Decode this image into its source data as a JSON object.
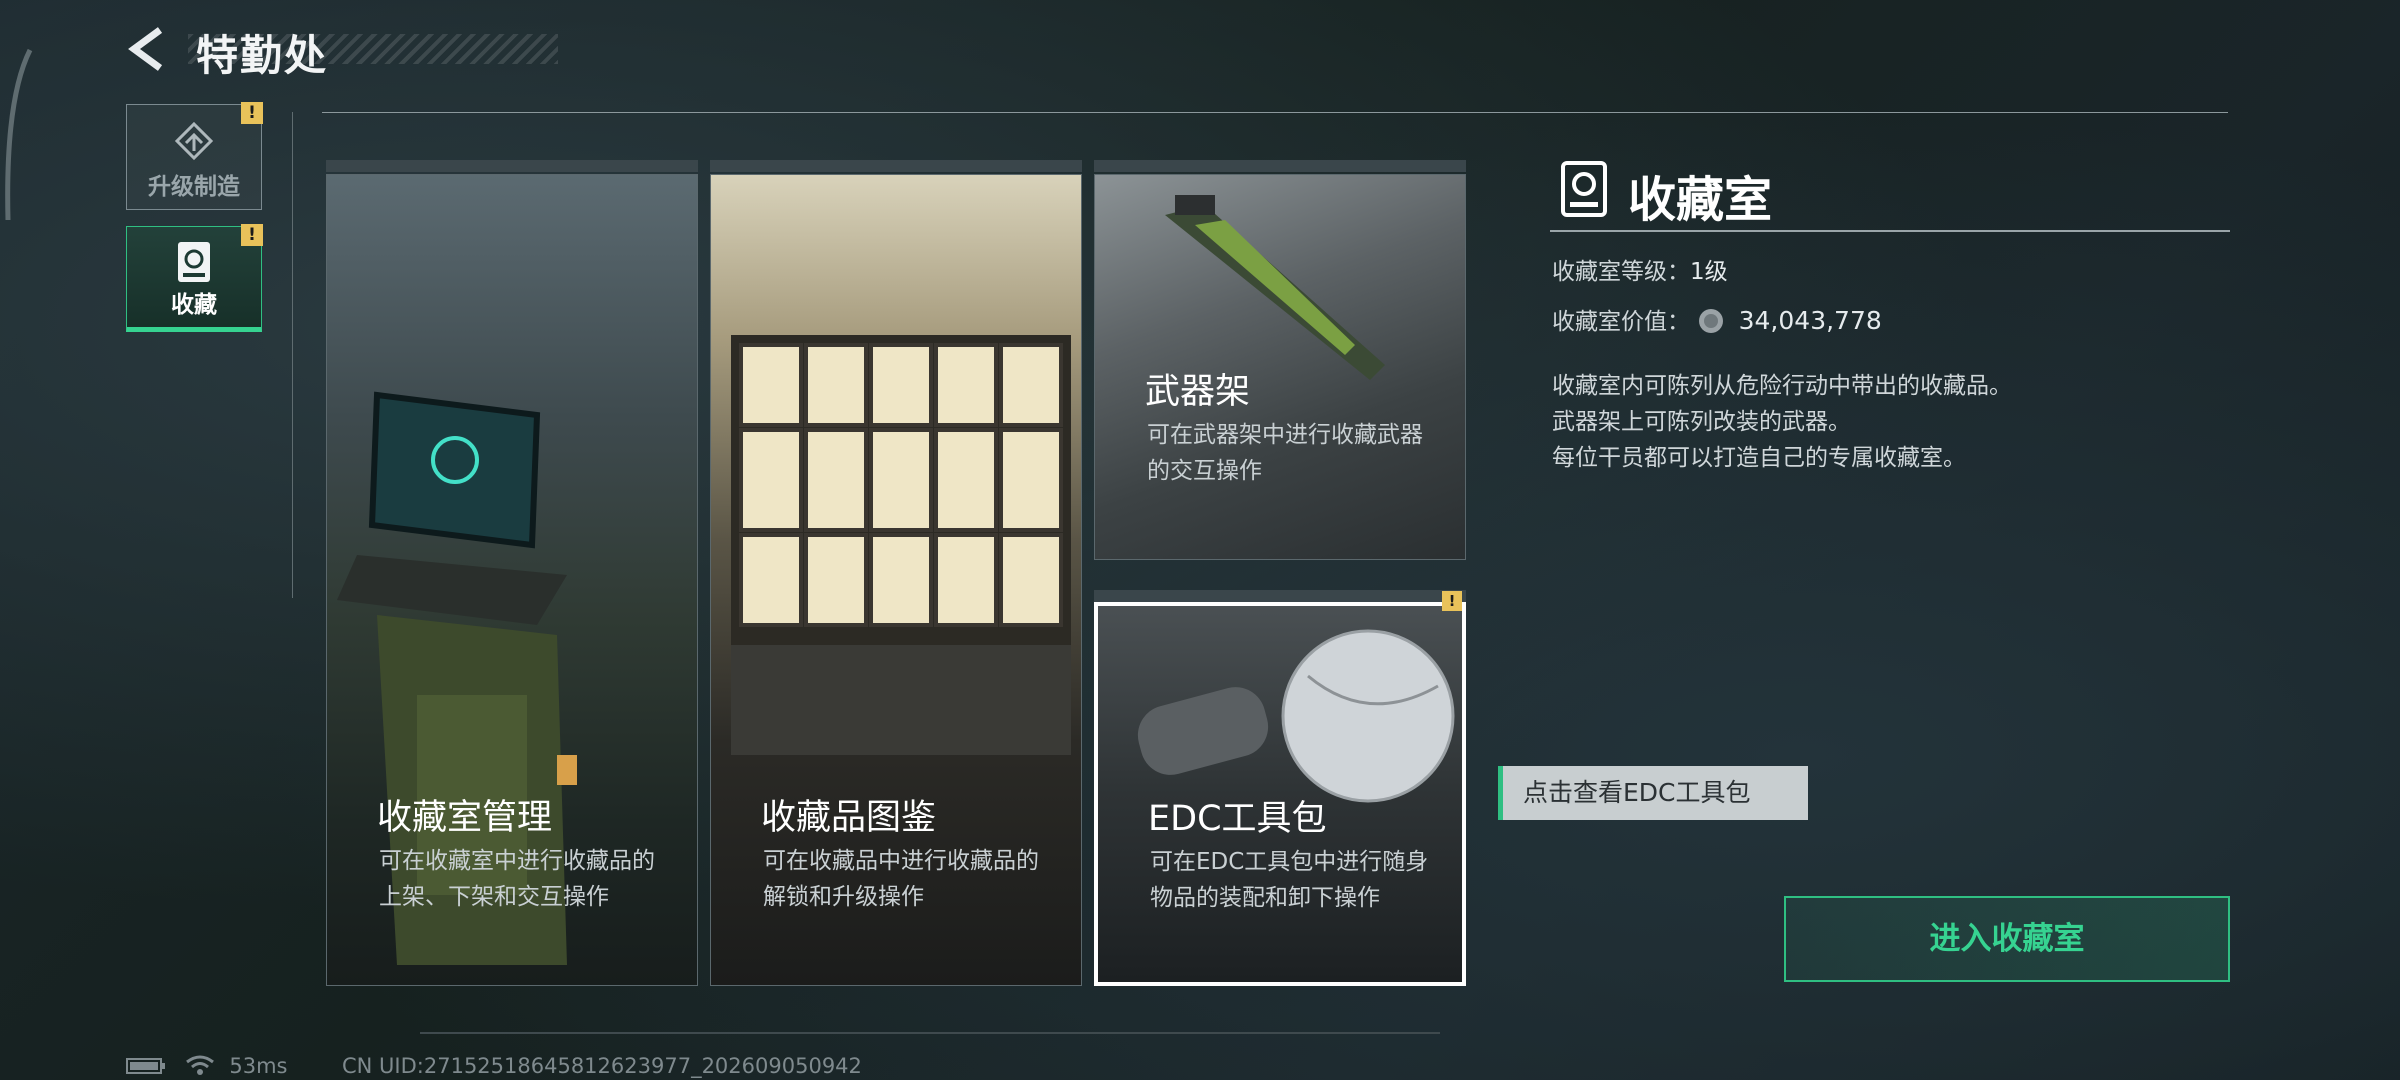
{
  "header": {
    "title": "特勤处"
  },
  "sidebar": {
    "tabs": [
      {
        "label": "升级制造",
        "alert": "!"
      },
      {
        "label": "收藏",
        "alert": "!"
      }
    ]
  },
  "cards": [
    {
      "name": "收藏室管理",
      "desc": "可在收藏室中进行收藏品的上架、下架和交互操作"
    },
    {
      "name": "收藏品图鉴",
      "desc": "可在收藏品中进行收藏品的解锁和升级操作"
    },
    {
      "name": "武器架",
      "desc": "可在武器架中进行收藏武器的交互操作"
    },
    {
      "name": "EDC工具包",
      "desc": "可在EDC工具包中进行随身物品的装配和卸下操作",
      "alert": "!"
    }
  ],
  "panel": {
    "title": "收藏室",
    "level_label": "收藏室等级：",
    "level_value": "1级",
    "value_label": "收藏室价值：",
    "value_amount": "34,043,778",
    "description": [
      "收藏室内可陈列从危险行动中带出的收藏品。",
      "武器架上可陈列改装的武器。",
      "每位干员都可以打造自己的专属收藏室。"
    ],
    "tooltip": "点击查看EDC工具包",
    "enter_button": "进入收藏室"
  },
  "status": {
    "ping": "53ms",
    "uid": "CN UID:27152518645812623977_202609050942"
  },
  "colors": {
    "accent": "#2fbf82",
    "alert": "#e9c25a"
  }
}
